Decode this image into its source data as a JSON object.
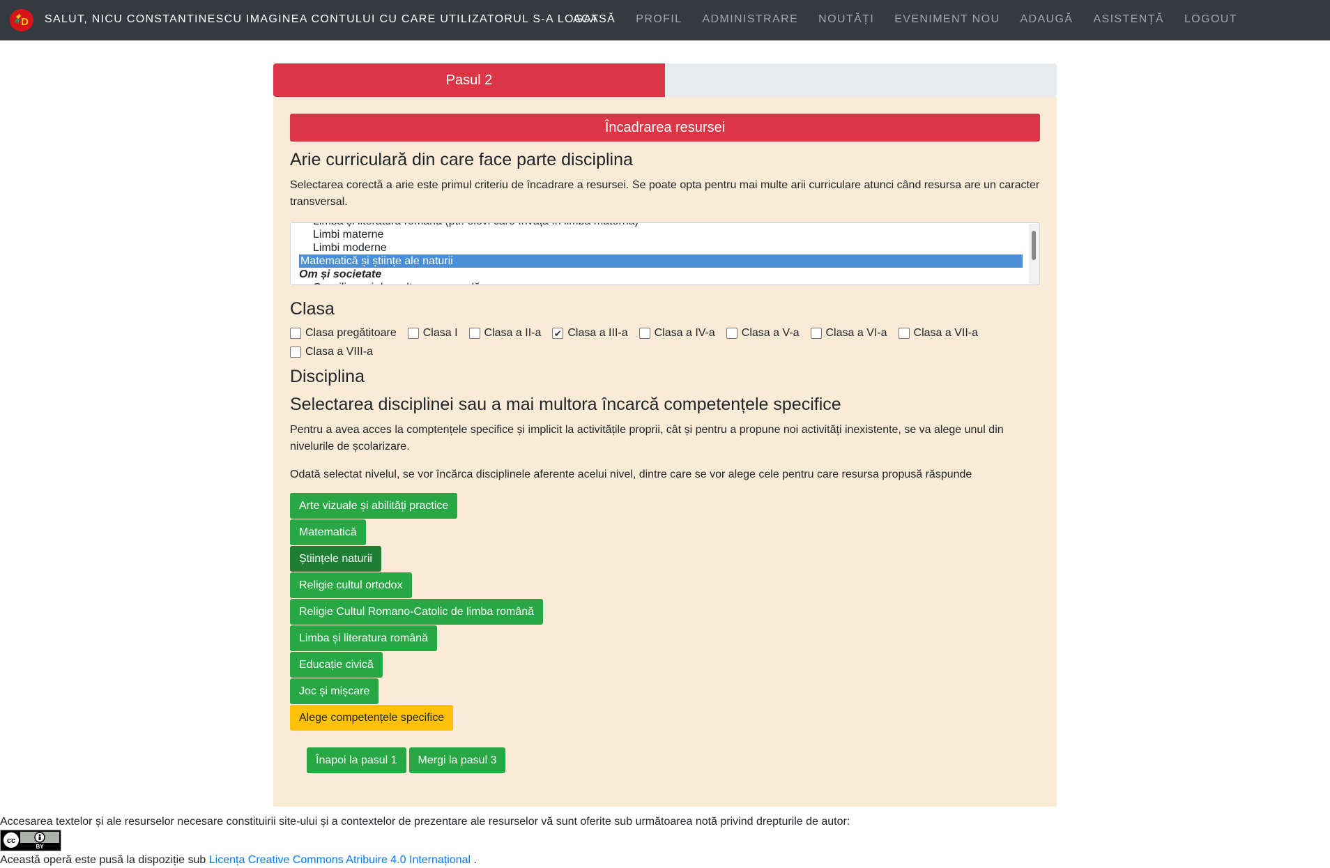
{
  "navbar": {
    "brand_text": "SALUT, NICU CONSTANTINESCU IMAGINEA CONTULUI CU CARE UTILIZATORUL S-A LOGAT",
    "items": [
      "ACASĂ",
      "PROFIL",
      "ADMINISTRARE",
      "NOUTĂȚI",
      "EVENIMENT NOU",
      "ADAUGĂ",
      "ASISTENȚĂ",
      "LOGOUT"
    ]
  },
  "progress": {
    "label": "Pasul 2",
    "value": 0.5,
    "color": "#dc3545"
  },
  "panel": {
    "header": "Încadrarea resursei",
    "arie_title": "Arie curriculară din care face parte disciplina",
    "arie_desc": "Selectarea corectă a arie este primul criteriu de încadrare a resursei. Se poate opta pentru mai multe arii curriculare atunci când resursa are un caracter transversal.",
    "arie_options": [
      {
        "text": "Limba și literatura română (ptr. elevi care învață în limba maternă)",
        "type": "option",
        "selected": false
      },
      {
        "text": "Limbi materne",
        "type": "option",
        "selected": false
      },
      {
        "text": "Limbi moderne",
        "type": "option",
        "selected": false
      },
      {
        "text": "Matematică și științe ale naturii",
        "type": "option",
        "selected": true
      },
      {
        "text": "Om și societate",
        "type": "group",
        "selected": false
      },
      {
        "text": "Consiliere și dezvoltare personală",
        "type": "option",
        "selected": false
      }
    ],
    "clasa_title": "Clasa",
    "clase": [
      {
        "label": "Clasa pregătitoare",
        "checked": false
      },
      {
        "label": "Clasa I",
        "checked": false
      },
      {
        "label": "Clasa a II-a",
        "checked": false
      },
      {
        "label": "Clasa a III-a",
        "checked": true
      },
      {
        "label": "Clasa a IV-a",
        "checked": false
      },
      {
        "label": "Clasa a V-a",
        "checked": false
      },
      {
        "label": "Clasa a VI-a",
        "checked": false
      },
      {
        "label": "Clasa a VII-a",
        "checked": false
      },
      {
        "label": "Clasa a VIII-a",
        "checked": false
      }
    ],
    "disciplina_title": "Disciplina",
    "selectare_title": "Selectarea disciplinei sau a mai multora încarcă competențele specifice",
    "acces_desc": "Pentru a avea acces la comptențele specifice și implicit la activitățile proprii, cât și pentru a propune noi activități inexistente, se va alege unul din nivelurile de școlarizare.",
    "odata_desc": "Odată selectat nivelul, se vor încărca disciplinele aferente acelui nivel, dintre care se vor alege cele pentru care resursa propusă răspunde",
    "discipline": [
      {
        "label": "Arte vizuale și abilități practice",
        "active": false
      },
      {
        "label": "Matematică",
        "active": false
      },
      {
        "label": "Științele naturii",
        "active": true
      },
      {
        "label": "Religie cultul ortodox",
        "active": false
      },
      {
        "label": "Religie Cultul Romano-Catolic de limba română",
        "active": false
      },
      {
        "label": "Limba și literatura română",
        "active": false
      },
      {
        "label": "Educație civică",
        "active": false
      },
      {
        "label": "Joc și mișcare",
        "active": false
      }
    ],
    "alege_button": "Alege competențele specifice",
    "back_button": "Înapoi la pasul 1",
    "next_button": "Mergi la pasul 3"
  },
  "footer": {
    "note": "Accesarea textelor și ale resurselor necesare constituirii site-ului și a contextelor de prezentare ale resurselor vă sunt oferite sub următoarea notă privind drepturile de autor:",
    "license_prefix": "Această operă este pusă la dispoziție sub",
    "license_link": "Licența Creative Commons Atribuire 4.0 Internațional",
    "license_suffix": ".",
    "badge": {
      "cc": "cc",
      "by": "BY"
    }
  },
  "colors": {
    "danger": "#dc3545",
    "success": "#28a745",
    "success_active": "#1e7e34",
    "warning": "#ffc107",
    "panel_bg": "#faebd7",
    "navbar_bg": "#343a40"
  }
}
